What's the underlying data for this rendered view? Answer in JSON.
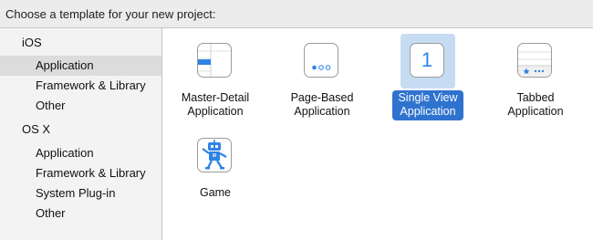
{
  "header": {
    "title": "Choose a template for your new project:"
  },
  "sidebar": {
    "groups": [
      {
        "label": "iOS",
        "items": [
          "Application",
          "Framework & Library",
          "Other"
        ]
      },
      {
        "label": "OS X",
        "items": [
          "Application",
          "Framework & Library",
          "System Plug-in",
          "Other"
        ]
      }
    ],
    "selected": "iOS/Application"
  },
  "templates": [
    {
      "line1": "Master-Detail",
      "line2": "Application",
      "icon": "master-detail-icon"
    },
    {
      "line1": "Page-Based",
      "line2": "Application",
      "icon": "page-based-icon"
    },
    {
      "line1": "Single View",
      "line2": "Application",
      "icon": "single-view-icon",
      "icon_text": "1",
      "selected": true
    },
    {
      "line1": "Tabbed",
      "line2": "Application",
      "icon": "tabbed-icon"
    },
    {
      "line1": "Game",
      "line2": "",
      "icon": "game-robot-icon"
    }
  ],
  "colors": {
    "accent": "#2f73cf",
    "selection_tint": "#c6dcf2",
    "icon_blue": "#2f83e6"
  }
}
